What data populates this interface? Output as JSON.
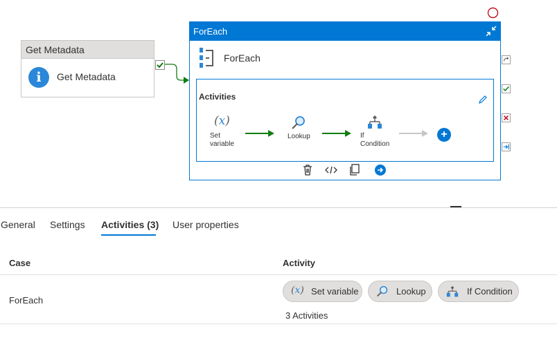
{
  "canvas": {
    "get_metadata": {
      "header": "Get Metadata",
      "label": "Get Metadata",
      "icon": "info-icon"
    },
    "foreach": {
      "header": "ForEach",
      "label": "ForEach",
      "activities_title": "Activities",
      "inner_activities": [
        {
          "label_lines": [
            "Set",
            "variable"
          ],
          "icon": "variable-icon"
        },
        {
          "label_lines": [
            "Lookup"
          ],
          "icon": "lookup-icon"
        },
        {
          "label_lines": [
            "If",
            "Condition"
          ],
          "icon": "if-condition-icon"
        }
      ]
    }
  },
  "tabs": [
    {
      "label": "General",
      "active": false
    },
    {
      "label": "Settings",
      "active": false
    },
    {
      "label": "Activities (3)",
      "active": true
    },
    {
      "label": "User properties",
      "active": false
    }
  ],
  "table": {
    "headers": {
      "case": "Case",
      "activity": "Activity"
    },
    "row": {
      "case": "ForEach",
      "activities": [
        {
          "label": "Set variable",
          "icon": "variable-icon"
        },
        {
          "label": "Lookup",
          "icon": "lookup-icon"
        },
        {
          "label": "If Condition",
          "icon": "if-condition-icon"
        }
      ],
      "summary": "3 Activities"
    }
  },
  "colors": {
    "accent": "#0078d4",
    "success": "#107c10",
    "error": "#c50f1f",
    "header_gray": "#e1dfdd"
  }
}
